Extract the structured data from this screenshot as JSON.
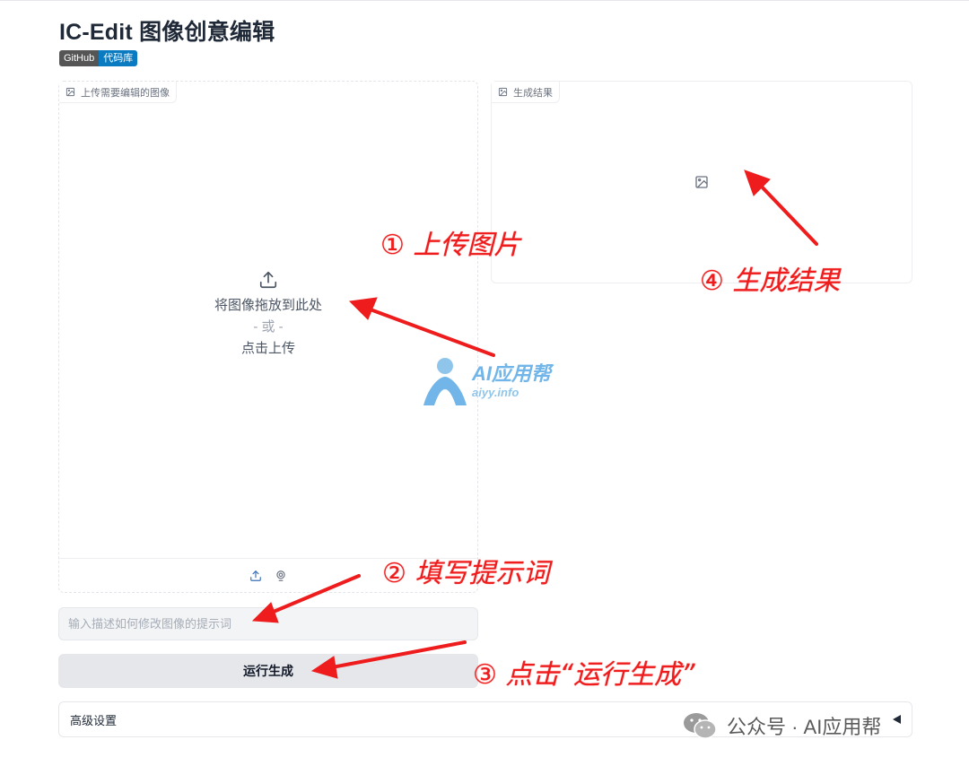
{
  "app": {
    "title": "IC-Edit 图像创意编辑"
  },
  "badge": {
    "left": "GitHub",
    "right": "代码库"
  },
  "upload": {
    "label": "上传需要编辑的图像",
    "drop_text": "将图像拖放到此处",
    "or_text": "- 或 -",
    "click_text": "点击上传"
  },
  "result": {
    "label": "生成结果"
  },
  "prompt": {
    "placeholder": "输入描述如何修改图像的提示词",
    "value": ""
  },
  "run_button": {
    "label": "运行生成"
  },
  "advanced": {
    "label": "高级设置"
  },
  "annotations": {
    "step1": "① 上传图片",
    "step2": "② 填写提示词",
    "step3": "③ 点击“运行生成”",
    "step4": "④ 生成结果"
  },
  "watermark": {
    "name": "AI应用帮",
    "domain": "aiyy.info"
  },
  "footer": {
    "text": "公众号 · AI应用帮"
  },
  "colors": {
    "annotation": "#ee1c1c",
    "badge_left": "#555555",
    "badge_right": "#0a7bc1",
    "watermark": "#5aa9e6"
  },
  "icons": [
    "image-icon",
    "upload-icon",
    "webcam-icon",
    "collapse-triangle-icon",
    "wechat-icon"
  ]
}
